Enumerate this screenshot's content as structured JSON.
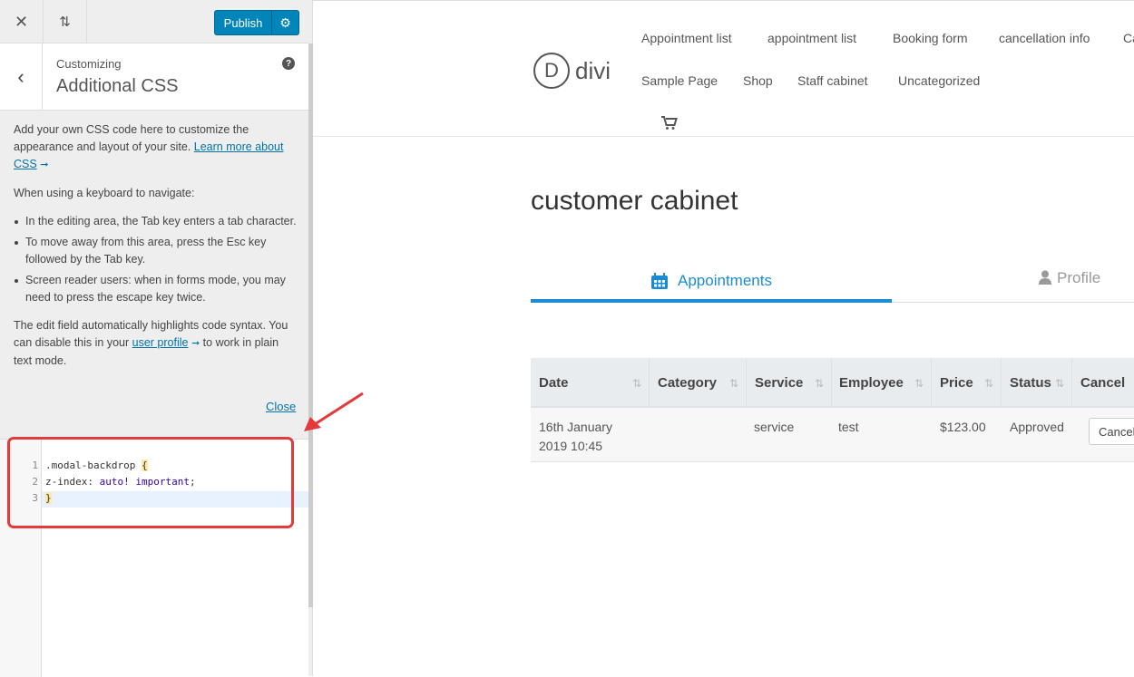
{
  "topbar": {
    "close_icon": "✕",
    "sort_icon": "⇅",
    "publish_label": "Publish",
    "gear_icon": "⚙",
    "accent": "#0085ba"
  },
  "section": {
    "back_icon": "‹",
    "customizing": "Customizing",
    "title": "Additional CSS",
    "help_icon": "?"
  },
  "description": {
    "intro": "Add your own CSS code here to customize the appearance and layout of your site.",
    "learn_more": "Learn more about CSS",
    "keyboard_intro": "When using a keyboard to navigate:",
    "bullets": [
      "In the editing area, the Tab key enters a tab character.",
      "To move away from this area, press the Esc key followed by the Tab key.",
      "Screen reader users: when in forms mode, you may need to press the escape key twice."
    ],
    "syntax_note_1": "The edit field automatically highlights code syntax. You can disable this in your",
    "user_profile": "user profile",
    "syntax_note_2": "to work in plain text mode.",
    "close": "Close"
  },
  "editor": {
    "line_numbers": [
      "1",
      "2",
      "3"
    ],
    "line1_text": ".modal-backdrop ",
    "line1_brace": "{",
    "line2_prop": "z-index: ",
    "line2_value": "auto! important",
    "line2_end": ";",
    "line3_brace": "}"
  },
  "site": {
    "logo_letter": "D",
    "logo_text": "divi",
    "nav": [
      "Appointment list",
      "appointment list",
      "Booking form",
      "cancellation info",
      "Ca",
      "Sample Page",
      "Shop",
      "Staff cabinet",
      "Uncategorized"
    ],
    "cart_icon": "shopping-cart-icon",
    "page_title": "customer cabinet",
    "tabs": {
      "appointments": "Appointments",
      "profile": "Profile"
    },
    "tab_accent": "#1b8cd2"
  },
  "table": {
    "headers": [
      "Date",
      "Category",
      "Service",
      "Employee",
      "Price",
      "Status",
      "Cancel"
    ],
    "row": {
      "date": "16th January 2019 10:45",
      "category": "",
      "service": "service",
      "employee": "test",
      "price": "$123.00",
      "status": "Approved",
      "cancel": "Cancel"
    }
  },
  "annotation": {
    "color": "#e33b3b"
  }
}
